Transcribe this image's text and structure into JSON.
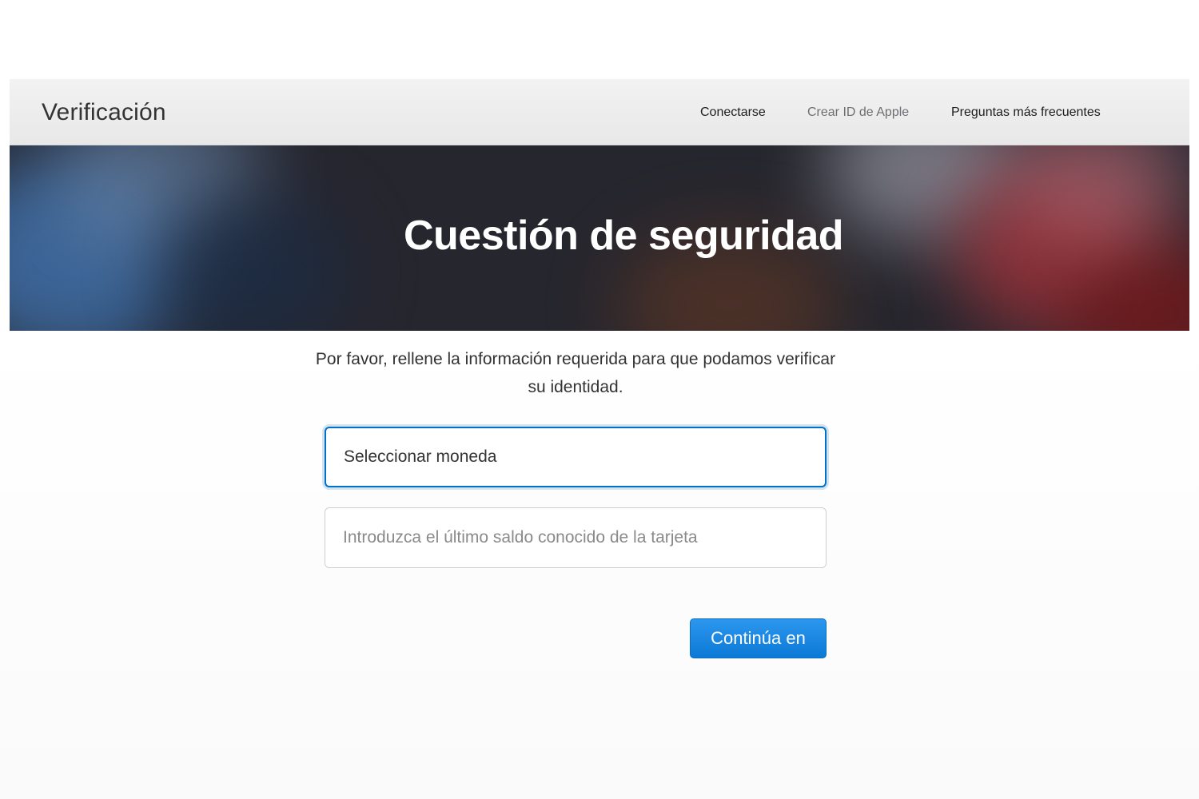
{
  "header": {
    "brand": "Verificación",
    "nav": [
      {
        "label": "Conectarse"
      },
      {
        "label": "Crear ID de Apple"
      },
      {
        "label": "Preguntas más frecuentes"
      }
    ]
  },
  "hero": {
    "title": "Cuestión de seguridad"
  },
  "form": {
    "intro": "Por favor, rellene la información requerida para que podamos verificar su identidad.",
    "currency_select": {
      "value": "Seleccionar moneda"
    },
    "balance_input": {
      "value": "",
      "placeholder": "Introduzca el último saldo conocido de la tarjeta"
    },
    "continue_label": "Continúa en"
  },
  "colors": {
    "accent": "#0070c9",
    "button": "#1a86e0",
    "header_bg": "#eeeeee"
  }
}
